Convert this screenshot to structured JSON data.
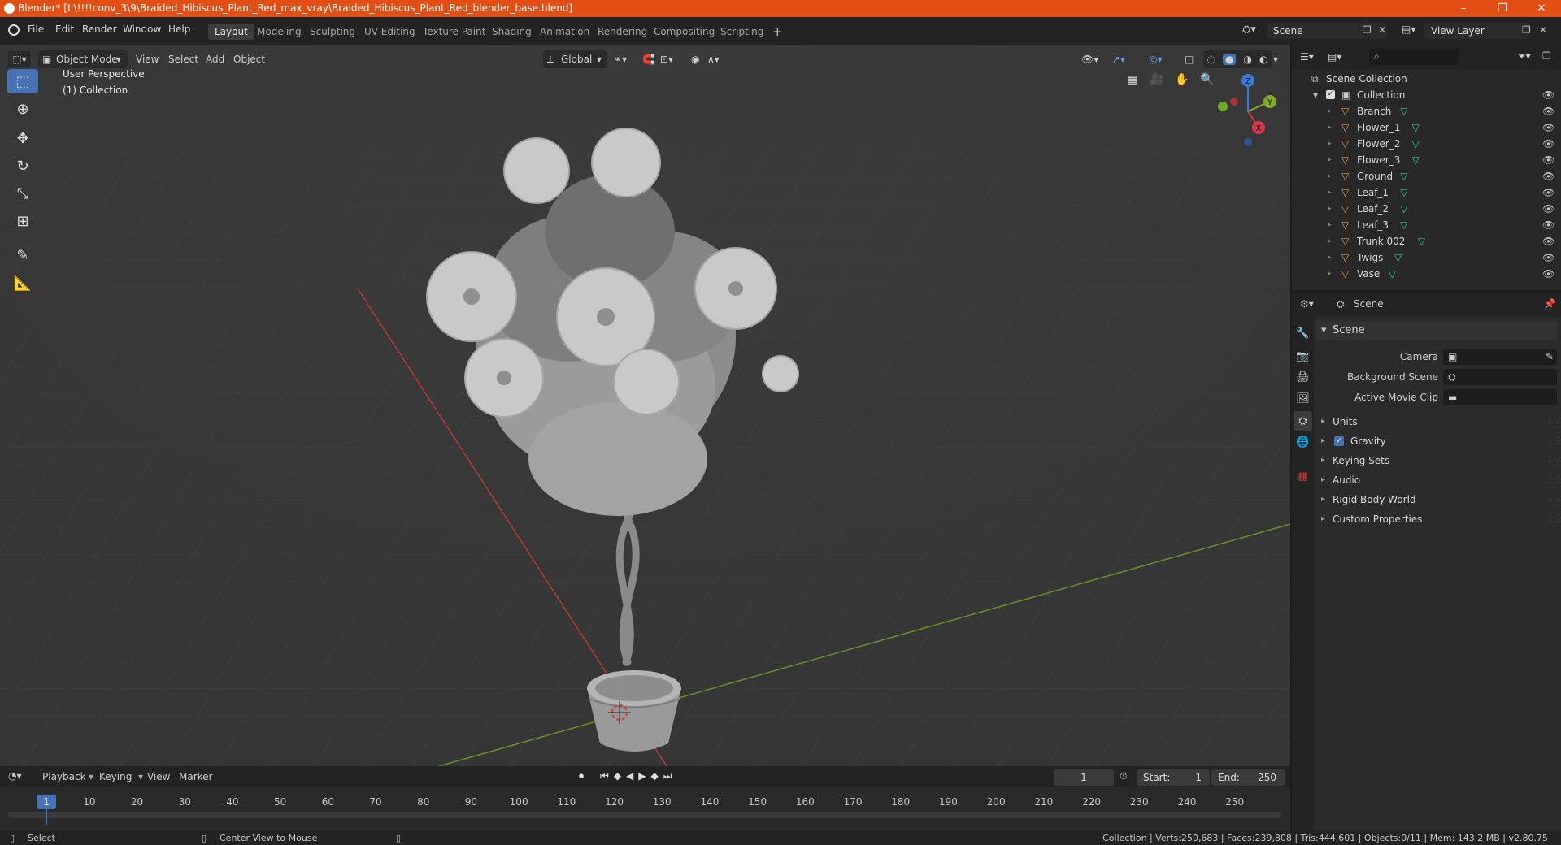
{
  "title_bar": {
    "text": "Blender* [I:\\!!!!conv_3\\9\\Braided_Hibiscus_Plant_Red_max_vray\\Braided_Hibiscus_Plant_Red_blender_base.blend]",
    "minimize": "–",
    "restore": "❐",
    "close": "✕"
  },
  "menu": {
    "items": [
      "File",
      "Edit",
      "Render",
      "Window",
      "Help"
    ],
    "workspaces": [
      "Layout",
      "Modeling",
      "Sculpting",
      "UV Editing",
      "Texture Paint",
      "Shading",
      "Animation",
      "Rendering",
      "Compositing",
      "Scripting"
    ],
    "active_workspace": "Layout",
    "add_workspace": "+",
    "scene": "Scene",
    "view_layer": "View Layer"
  },
  "viewport": {
    "mode": "Object Mode",
    "menus": [
      "View",
      "Select",
      "Add",
      "Object"
    ],
    "transform_orientation": "Global",
    "perspective_label": "User Perspective",
    "collection_label": "(1) Collection",
    "gizmo": {
      "z": "Z",
      "y": "Y",
      "x": "X"
    }
  },
  "outliner": {
    "search_placeholder": "",
    "scene_collection": "Scene Collection",
    "collection": "Collection",
    "objects": [
      "Branch",
      "Flower_1",
      "Flower_2",
      "Flower_3",
      "Ground",
      "Leaf_1",
      "Leaf_2",
      "Leaf_3",
      "Trunk.002",
      "Twigs",
      "Vase"
    ]
  },
  "properties": {
    "header": "Scene",
    "panel_title": "Scene",
    "fields": [
      {
        "label": "Camera",
        "value": ""
      },
      {
        "label": "Background Scene",
        "value": ""
      },
      {
        "label": "Active Movie Clip",
        "value": ""
      }
    ],
    "sections": [
      "Units",
      "Gravity",
      "Keying Sets",
      "Audio",
      "Rigid Body World",
      "Custom Properties"
    ],
    "gravity_checked": true
  },
  "timeline": {
    "menus": [
      "Playback",
      "Keying",
      "View",
      "Marker"
    ],
    "current_frame": "1",
    "start_label": "Start:",
    "start": "1",
    "end_label": "End:",
    "end": "250",
    "ticks": [
      "10",
      "20",
      "30",
      "40",
      "50",
      "60",
      "70",
      "80",
      "90",
      "100",
      "110",
      "120",
      "130",
      "140",
      "150",
      "160",
      "170",
      "180",
      "190",
      "200",
      "210",
      "220",
      "230",
      "240",
      "250"
    ],
    "playhead": "1"
  },
  "status_bar": {
    "left_action": "Select",
    "middle_action": "Center View to Mouse",
    "stats": "Collection | Verts:250,683 | Faces:239,808 | Tris:444,601 | Objects:0/11 | Mem: 143.2 MB | v2.80.75"
  },
  "colors": {
    "title_bar": "#e34e14",
    "accent": "#4772b3",
    "viewport_bg": "#393939",
    "x_axis": "#b33a3a",
    "y_axis": "#6d8f28",
    "mesh_icon": "#3fc6a1",
    "object_icon": "#e69a3d"
  }
}
